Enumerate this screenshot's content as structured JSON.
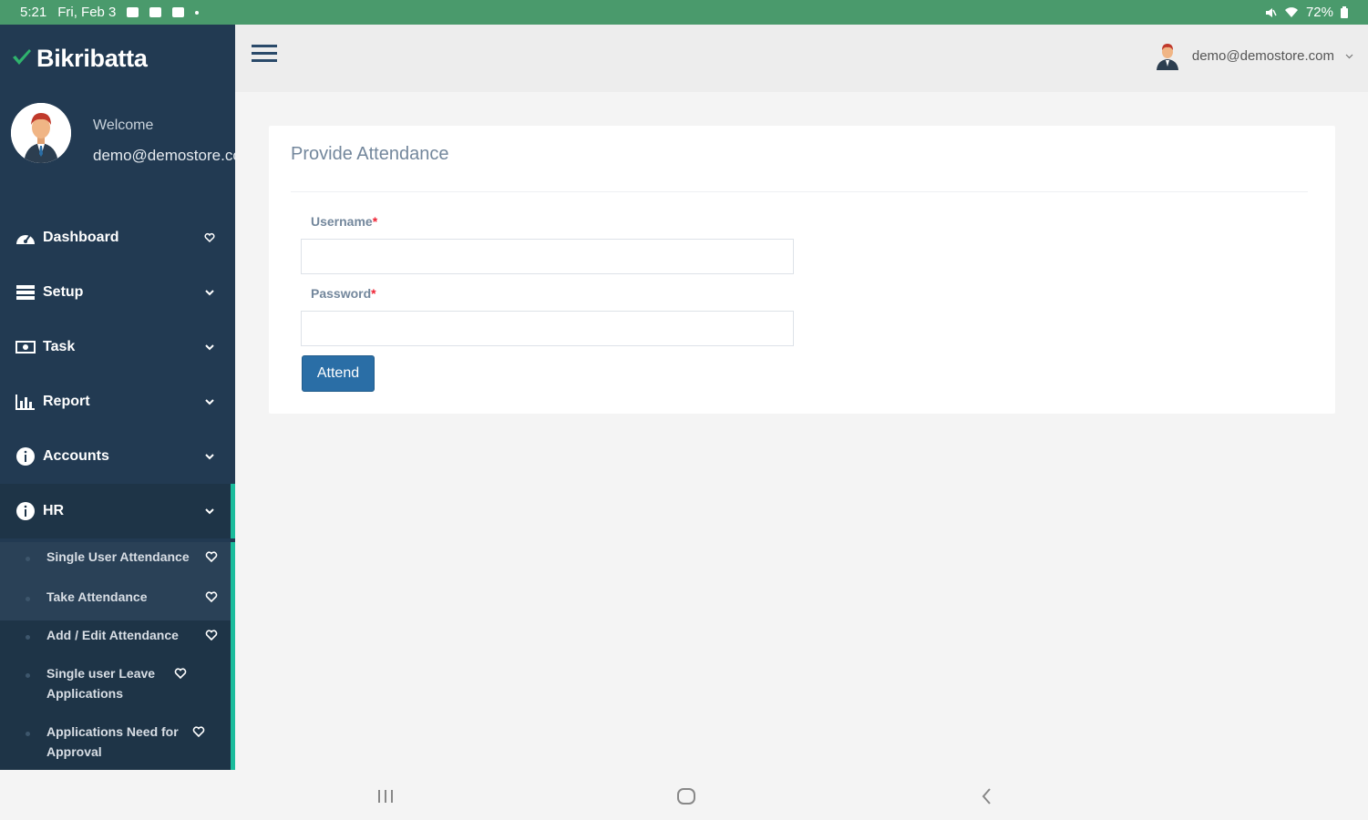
{
  "status_bar": {
    "time": "5:21",
    "date": "Fri, Feb 3",
    "battery": "72%"
  },
  "colors": {
    "status_bar": "#4a9a6c",
    "sidebar": "#223a52",
    "accent": "#1abc9c",
    "primary_button": "#2a6ea6",
    "required": "#ee2233"
  },
  "sidebar": {
    "brand": "Bikribatta",
    "welcome": "Welcome",
    "user_email": "demo@demostore.com",
    "items": [
      {
        "label": "Dashboard",
        "icon": "dashboard-icon"
      },
      {
        "label": "Setup",
        "icon": "server-icon"
      },
      {
        "label": "Task",
        "icon": "money-icon"
      },
      {
        "label": "Report",
        "icon": "bar-chart-icon"
      },
      {
        "label": "Accounts",
        "icon": "info-icon"
      },
      {
        "label": "HR",
        "icon": "info-icon"
      }
    ],
    "hr_subitems": [
      {
        "label": "Single User Attendance"
      },
      {
        "label": "Take Attendance"
      },
      {
        "label": "Add / Edit Attendance"
      },
      {
        "label": "Single user Leave Applications"
      },
      {
        "label": "Applications Need for Approval"
      }
    ]
  },
  "header": {
    "user_email": "demo@demostore.com"
  },
  "form": {
    "title": "Provide Attendance",
    "username_label": "Username",
    "password_label": "Password",
    "required_mark": "*",
    "username_value": "",
    "password_value": "",
    "submit_label": "Attend"
  }
}
